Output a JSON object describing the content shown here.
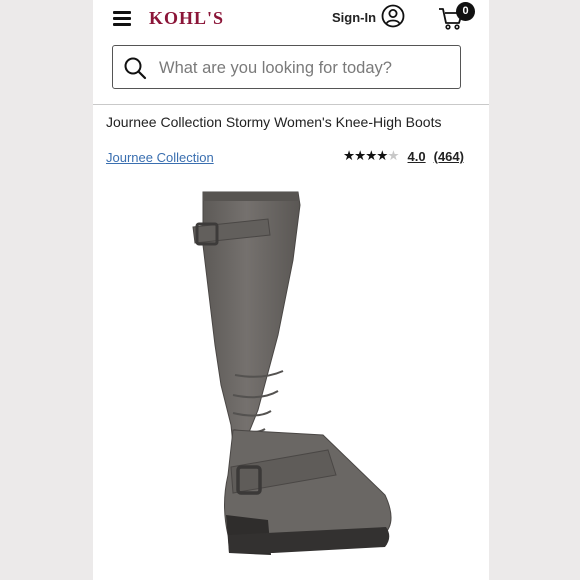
{
  "header": {
    "logo_text": "KOHL'S",
    "signin_label": "Sign-In",
    "cart_count": "0"
  },
  "search": {
    "placeholder": "What are you looking for today?"
  },
  "product": {
    "title": "Journee Collection Stormy Women's Knee-High Boots",
    "brand": "Journee Collection",
    "rating_value": "4.0",
    "review_count": "(464)",
    "stars_filled": "★★★★",
    "stars_empty": "★",
    "image_icon": "knee-high-boot-image"
  },
  "colors": {
    "brand": "#8b1538",
    "link": "#3a6fb0",
    "boot": "#6e6b68"
  }
}
